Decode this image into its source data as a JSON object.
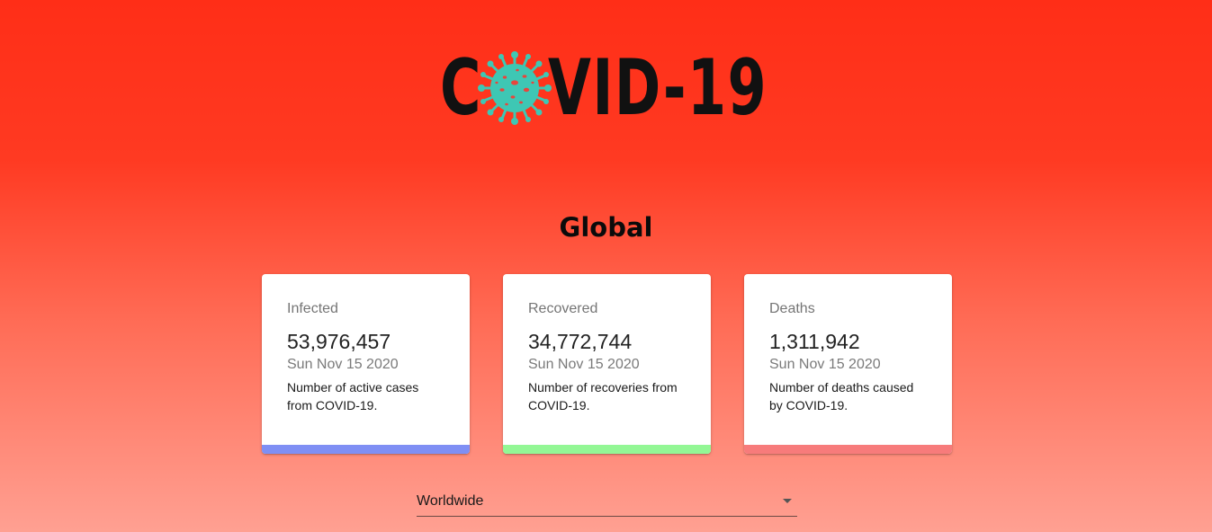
{
  "header": {
    "logo_first": "C",
    "logo_rest": "VID-19",
    "logo_icon": "coronavirus-icon"
  },
  "heading": "Global",
  "cards": [
    {
      "label": "Infected",
      "value": "53,976,457",
      "date": "Sun Nov 15 2020",
      "description": "Number of active cases from COVID-19.",
      "accent": "#7f8ff4"
    },
    {
      "label": "Recovered",
      "value": "34,772,744",
      "date": "Sun Nov 15 2020",
      "description": "Number of recoveries from COVID-19.",
      "accent": "#93f795"
    },
    {
      "label": "Deaths",
      "value": "1,311,942",
      "date": "Sun Nov 15 2020",
      "description": "Number of deaths caused by COVID-19.",
      "accent": "#f77b7b"
    }
  ],
  "country_picker": {
    "selected": "Worldwide",
    "icon": "arrow-drop-down-icon"
  },
  "colors": {
    "background_top": "#ff2e17",
    "background_bottom": "#ffa092",
    "virus": "#3ec7b4",
    "virus_spots": "#e8453c"
  }
}
